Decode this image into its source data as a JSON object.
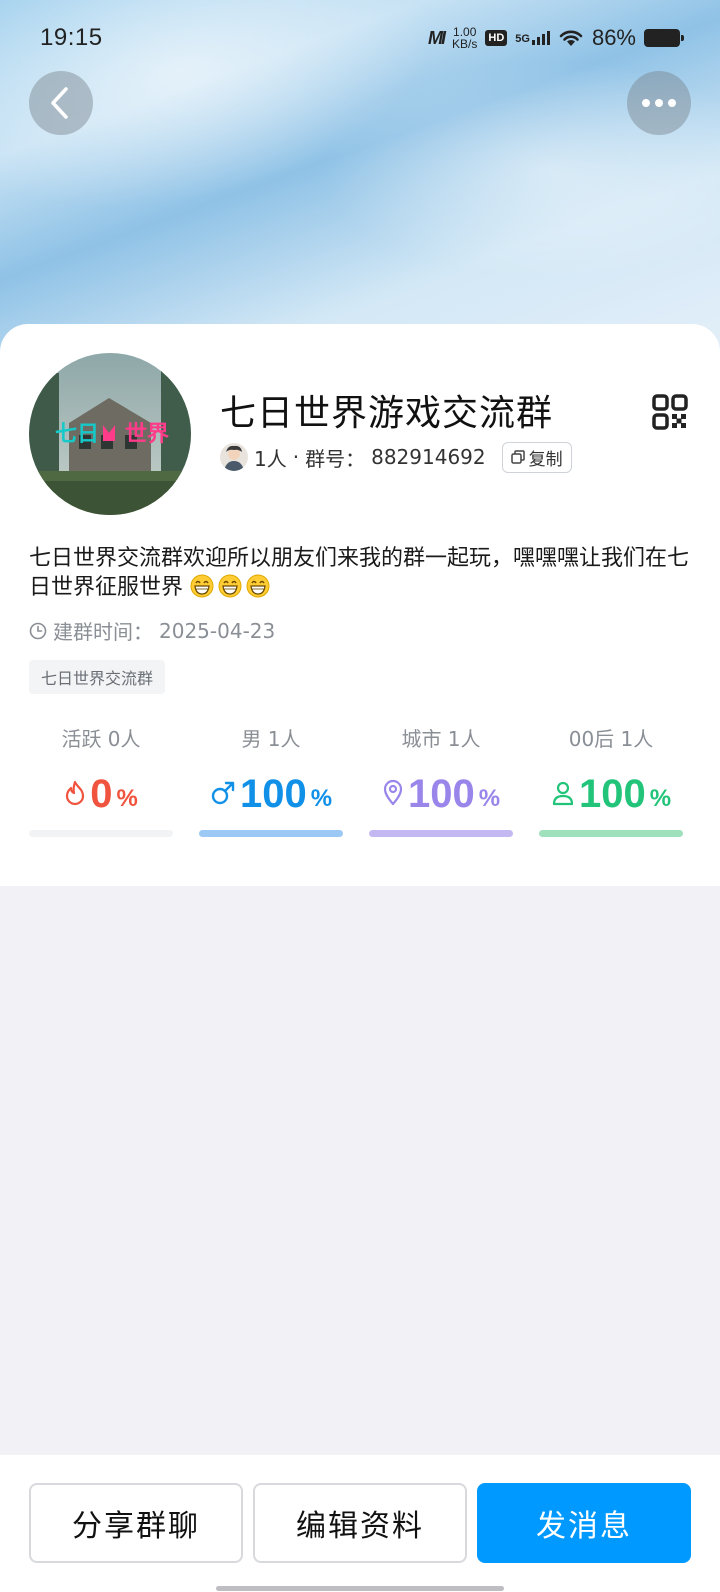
{
  "status_bar": {
    "time": "19:15",
    "carrier_logo": "MI",
    "net_speed_value": "1.00",
    "net_speed_unit": "KB/s",
    "hd_label": "HD",
    "network_label": "5G",
    "battery_percent": "86%"
  },
  "group": {
    "name": "七日世界游戏交流群",
    "member_count": "1人",
    "separator": "·",
    "id_label": "群号：",
    "id_value": "882914692",
    "copy_label": "复制",
    "description": "七日世界交流群欢迎所以朋友们来我的群一起玩，嘿嘿嘿让我们在七日世界征服世界",
    "description_emoji_count": 3,
    "created_label": "建群时间：",
    "created_date": "2025-04-23",
    "tag": "七日世界交流群",
    "avatar_logo_text": {
      "part1": "七日",
      "part2": "世界"
    }
  },
  "stats": [
    {
      "label": "活跃 0人",
      "value": "0",
      "unit": "%",
      "icon": "flame-icon",
      "color": "#f0533e",
      "bar_color": "#f2f3f5",
      "fill_percent": 0
    },
    {
      "label": "男 1人",
      "value": "100",
      "unit": "%",
      "icon": "male-icon",
      "color": "#1190e8",
      "bar_color": "#9cc8f5",
      "fill_percent": 100
    },
    {
      "label": "城市 1人",
      "value": "100",
      "unit": "%",
      "icon": "location-pin-icon",
      "color": "#9a86ea",
      "bar_color": "#c4b8f3",
      "fill_percent": 100
    },
    {
      "label": "00后 1人",
      "value": "100",
      "unit": "%",
      "icon": "person-icon",
      "color": "#22c47a",
      "bar_color": "#9fe0bd",
      "fill_percent": 100
    }
  ],
  "actions": {
    "share": "分享群聊",
    "edit": "编辑资料",
    "message": "发消息"
  },
  "colors": {
    "primary": "#0099ff",
    "page_bg": "#f1f1f6"
  }
}
